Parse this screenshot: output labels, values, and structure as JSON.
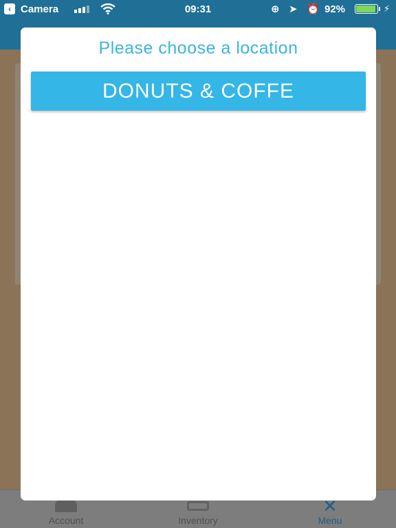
{
  "status_bar": {
    "back_glyph": "‹",
    "carrier": "Camera",
    "wifi_icon": "wifi-icon",
    "time": "09:31",
    "lock_icon": "⊕",
    "location_icon": "➤",
    "alarm_icon": "⏰",
    "battery_percent": "92%",
    "battery_level": 0.92,
    "charging_icon": "⚡",
    "colors": {
      "bar": "#1f6f96",
      "battery_fill": "#7ed957"
    }
  },
  "modal": {
    "title": "Please choose a location",
    "locations": [
      {
        "label": "DONUTS & COFFE"
      }
    ],
    "colors": {
      "title": "#3ab4e4",
      "button": "#34b6e6"
    }
  },
  "tab_bar": {
    "tabs": [
      {
        "label": "Account",
        "icon": "account-icon"
      },
      {
        "label": "Inventory",
        "icon": "inventory-icon"
      },
      {
        "label": "Menu",
        "icon": "menu-close-icon",
        "selected": true
      }
    ]
  }
}
